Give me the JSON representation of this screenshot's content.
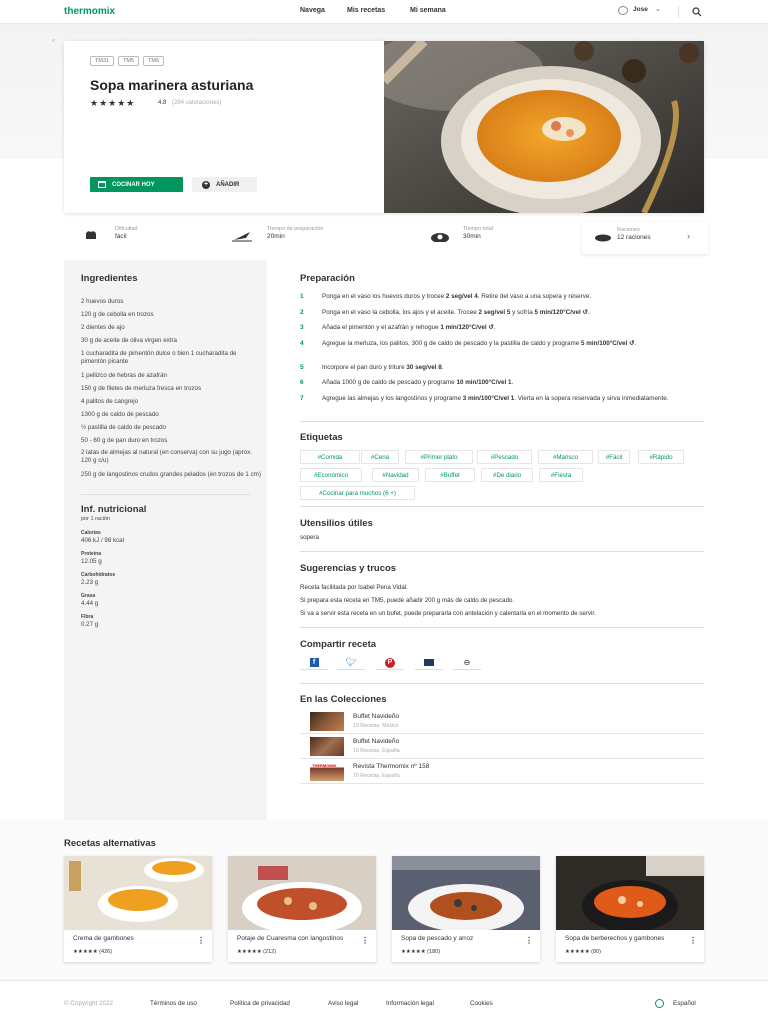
{
  "header": {
    "logo": "thermomix",
    "nav": [
      "Navega",
      "Mis recetas",
      "Mi semana"
    ],
    "user": "Jose"
  },
  "recipe": {
    "devices": [
      "TM31",
      "TM5",
      "TM6"
    ],
    "title": "Sopa marinera asturiana",
    "rating": "4.8",
    "ratings_count": "(284 valoraciones)",
    "cook_button": "COCINAR HOY",
    "add_button": "AÑADIR"
  },
  "meta": [
    {
      "label": "Dificultad",
      "value": "fácil"
    },
    {
      "label": "Tiempo de preparación",
      "value": "20min"
    },
    {
      "label": "Tiempo total",
      "value": "30min"
    },
    {
      "label": "Raciones",
      "value": "12 raciones"
    }
  ],
  "ingredients": {
    "title": "Ingredientes",
    "items": [
      "2 huevos duros",
      "120 g de cebolla en trozos",
      "2 dientes de ajo",
      "30 g de aceite de oliva virgen extra",
      "1 cucharadita de pimentón dulce o bien 1 cucharadita de pimentón picante",
      "1 pellizco de hebras de azafrán",
      "150 g de filetes de merluza fresca en trozos",
      "4 palitos de cangrejo",
      "1300 g de caldo de pescado",
      "½ pastilla de caldo de pescado",
      "50 - 60 g de pan duro en trozos",
      "2 latas de almejas al natural (en conserva) con su jugo (aprox. 120 g c/u)",
      "250 g de langostinos crudos grandes pelados (en trozos de 1 cm)"
    ]
  },
  "nutrition": {
    "title": "Inf. nutricional",
    "subtitle": "por 1 ración",
    "items": [
      {
        "label": "Calorías",
        "value": "406 kJ / 98 kcal"
      },
      {
        "label": "Proteína",
        "value": "12.05 g"
      },
      {
        "label": "Carbohidratos",
        "value": "2.23 g"
      },
      {
        "label": "Grasa",
        "value": "4.44 g"
      },
      {
        "label": "Fibra",
        "value": "0.27 g"
      }
    ]
  },
  "preparation": {
    "title": "Preparación",
    "steps": [
      {
        "n": "1",
        "text": "Ponga en el vaso los huevos duros y trocee <b>2 seg/vel 4</b>. Retire del vaso a una sopera y reserve."
      },
      {
        "n": "2",
        "text": "Ponga en el vaso la cebolla, los ajos y el aceite. Trocee <b>2 seg/vel 5</b> y sofría <b>5 min/120°C/vel ↺</b>."
      },
      {
        "n": "3",
        "text": "Añada el pimentón y el azafrán y rehogue <b>1 min/120°C/vel ↺</b>."
      },
      {
        "n": "4",
        "text": "Agregue la merluza, los palitos, 300 g de caldo de pescado y la pastilla de caldo y programe <b>5 min/100°C/vel ↺</b>."
      },
      {
        "n": "5",
        "text": "Incorpore el pan duro y triture <b>30 seg/vel 8</b>."
      },
      {
        "n": "6",
        "text": "Añada 1000 g de caldo de pescado y programe <b>10 min/100°C/vel 1</b>."
      },
      {
        "n": "7",
        "text": "Agregue las almejas y los langostinos y programe <b>3 min/100°C/vel 1</b>. Vierta en la sopera reservada y sirva inmediatamente."
      }
    ]
  },
  "tags": {
    "title": "Etiquetas",
    "items": [
      "#Comida",
      "#Cena",
      "#Primer plato",
      "#Pescado",
      "#Marisco",
      "#Fácil",
      "#Rápido",
      "#Económico",
      "#Navidad",
      "#Buffet",
      "#De diario",
      "#Fiesta",
      "#Cocinar para muchos (6 +)"
    ]
  },
  "utensils": {
    "title": "Utensilios útiles",
    "text": "sopera"
  },
  "tips": {
    "title": "Sugerencias y trucos",
    "items": [
      "Receta facilitada por Isabel Pena Vidal.",
      "Si prepara esta receta en TM5, puede añadir 200 g más de caldo de pescado.",
      "Si va a servir esta receta en un bufet, puede prepararla con antelación y calentarla en el momento de servir."
    ]
  },
  "share": {
    "title": "Compartir receta"
  },
  "collections": {
    "title": "En las Colecciones",
    "items": [
      {
        "name": "Buffet Navideño",
        "sub": "19 Recetas, México"
      },
      {
        "name": "Buffet Navideño",
        "sub": "19 Recetas, España"
      },
      {
        "name": "Revista Thermomix nº 158",
        "sub": "70 Recetas, España"
      }
    ],
    "thumb_text": "THERMOMIX"
  },
  "alternatives": {
    "title": "Recetas alternativas",
    "items": [
      {
        "name": "Crema de gambones",
        "count": "(426)"
      },
      {
        "name": "Potaje de Cuaresma con langostinos",
        "count": "(212)"
      },
      {
        "name": "Sopa de pescado y arroz",
        "count": "(180)"
      },
      {
        "name": "Sopa de berberechos y gambones",
        "count": "(80)"
      }
    ],
    "stars": "★★★★★"
  },
  "footer": {
    "copyright": "© Copyright 2022",
    "links": [
      "Términos de uso",
      "Política de privacidad",
      "Aviso legal",
      "Información legal",
      "Cookies"
    ],
    "language": "Español"
  },
  "colors": {
    "accent": "#00965e",
    "sidebar": "#f4f4f4"
  }
}
